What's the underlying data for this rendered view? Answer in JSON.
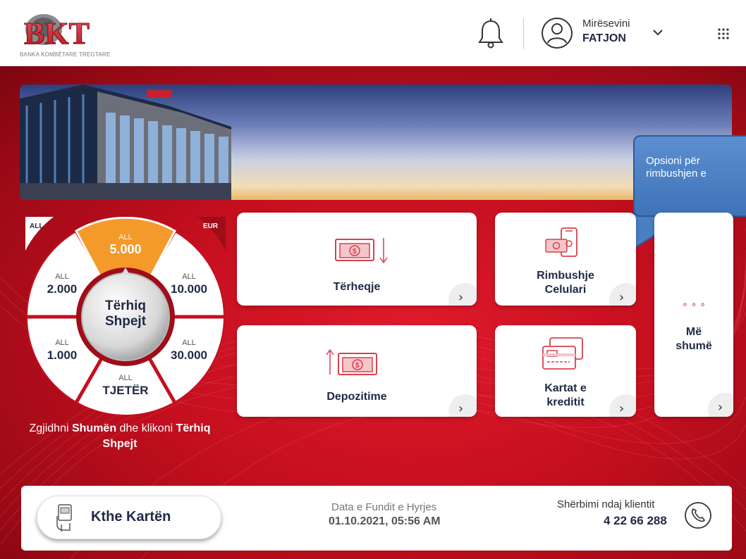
{
  "header": {
    "logo_text": "BKT",
    "logo_tagline": "BANKA KOMBËTARE TREGTARE",
    "icons": [
      "bell-icon",
      "user-avatar-icon",
      "chevron-down-icon",
      "apps-grid-icon"
    ],
    "welcome": "Mirësevini",
    "username": "FATJON"
  },
  "callout": {
    "line1": "Opsioni për",
    "line2": "rimbushjen e"
  },
  "quick_withdraw": {
    "currency_left": "ALL",
    "currency_right": "EUR",
    "center_line1": "Tërhiq",
    "center_line2": "Shpejt",
    "segments": [
      {
        "currency": "ALL",
        "amount": "5.000",
        "selected": true
      },
      {
        "currency": "ALL",
        "amount": "10.000",
        "selected": false
      },
      {
        "currency": "ALL",
        "amount": "30.000",
        "selected": false
      },
      {
        "currency": "ALL",
        "amount": "TJETËR",
        "selected": false
      },
      {
        "currency": "ALL",
        "amount": "1.000",
        "selected": false
      },
      {
        "currency": "ALL",
        "amount": "2.000",
        "selected": false
      }
    ],
    "caption_part1": "Zgjidhni ",
    "caption_bold1": "Shumën",
    "caption_part2": " dhe klikoni ",
    "caption_bold2": "Tërhiq",
    "caption_bold3": "Shpejt"
  },
  "tiles": {
    "withdraw": {
      "label": "Tërheqje",
      "icon": "cash-withdraw-icon"
    },
    "topup": {
      "label_line1": "Rimbushje",
      "label_line2": "Celulari",
      "icon": "mobile-topup-icon"
    },
    "more": {
      "dots": "∘ ∘ ∘",
      "label_line1": "Më",
      "label_line2": "shumë"
    },
    "deposit": {
      "label": "Depozitime",
      "icon": "cash-deposit-icon"
    },
    "cards": {
      "label_line1": "Kartat e",
      "label_line2": "kreditit",
      "icon": "credit-cards-icon"
    },
    "arrow": "›"
  },
  "bottom": {
    "return_card": "Kthe Kartën",
    "last_login_label": "Data e Fundit e Hyrjes",
    "last_login_value": "01.10.2021, 05:56 AM",
    "support_label": "Shërbimi ndaj klientit",
    "support_number": "4 22 66 288"
  },
  "colors": {
    "brand_red": "#c40f1f",
    "accent_orange": "#f39a2b",
    "icon_red": "#d9404c",
    "callout_blue": "#4a7fc4",
    "text_dark": "#1f2a44"
  }
}
